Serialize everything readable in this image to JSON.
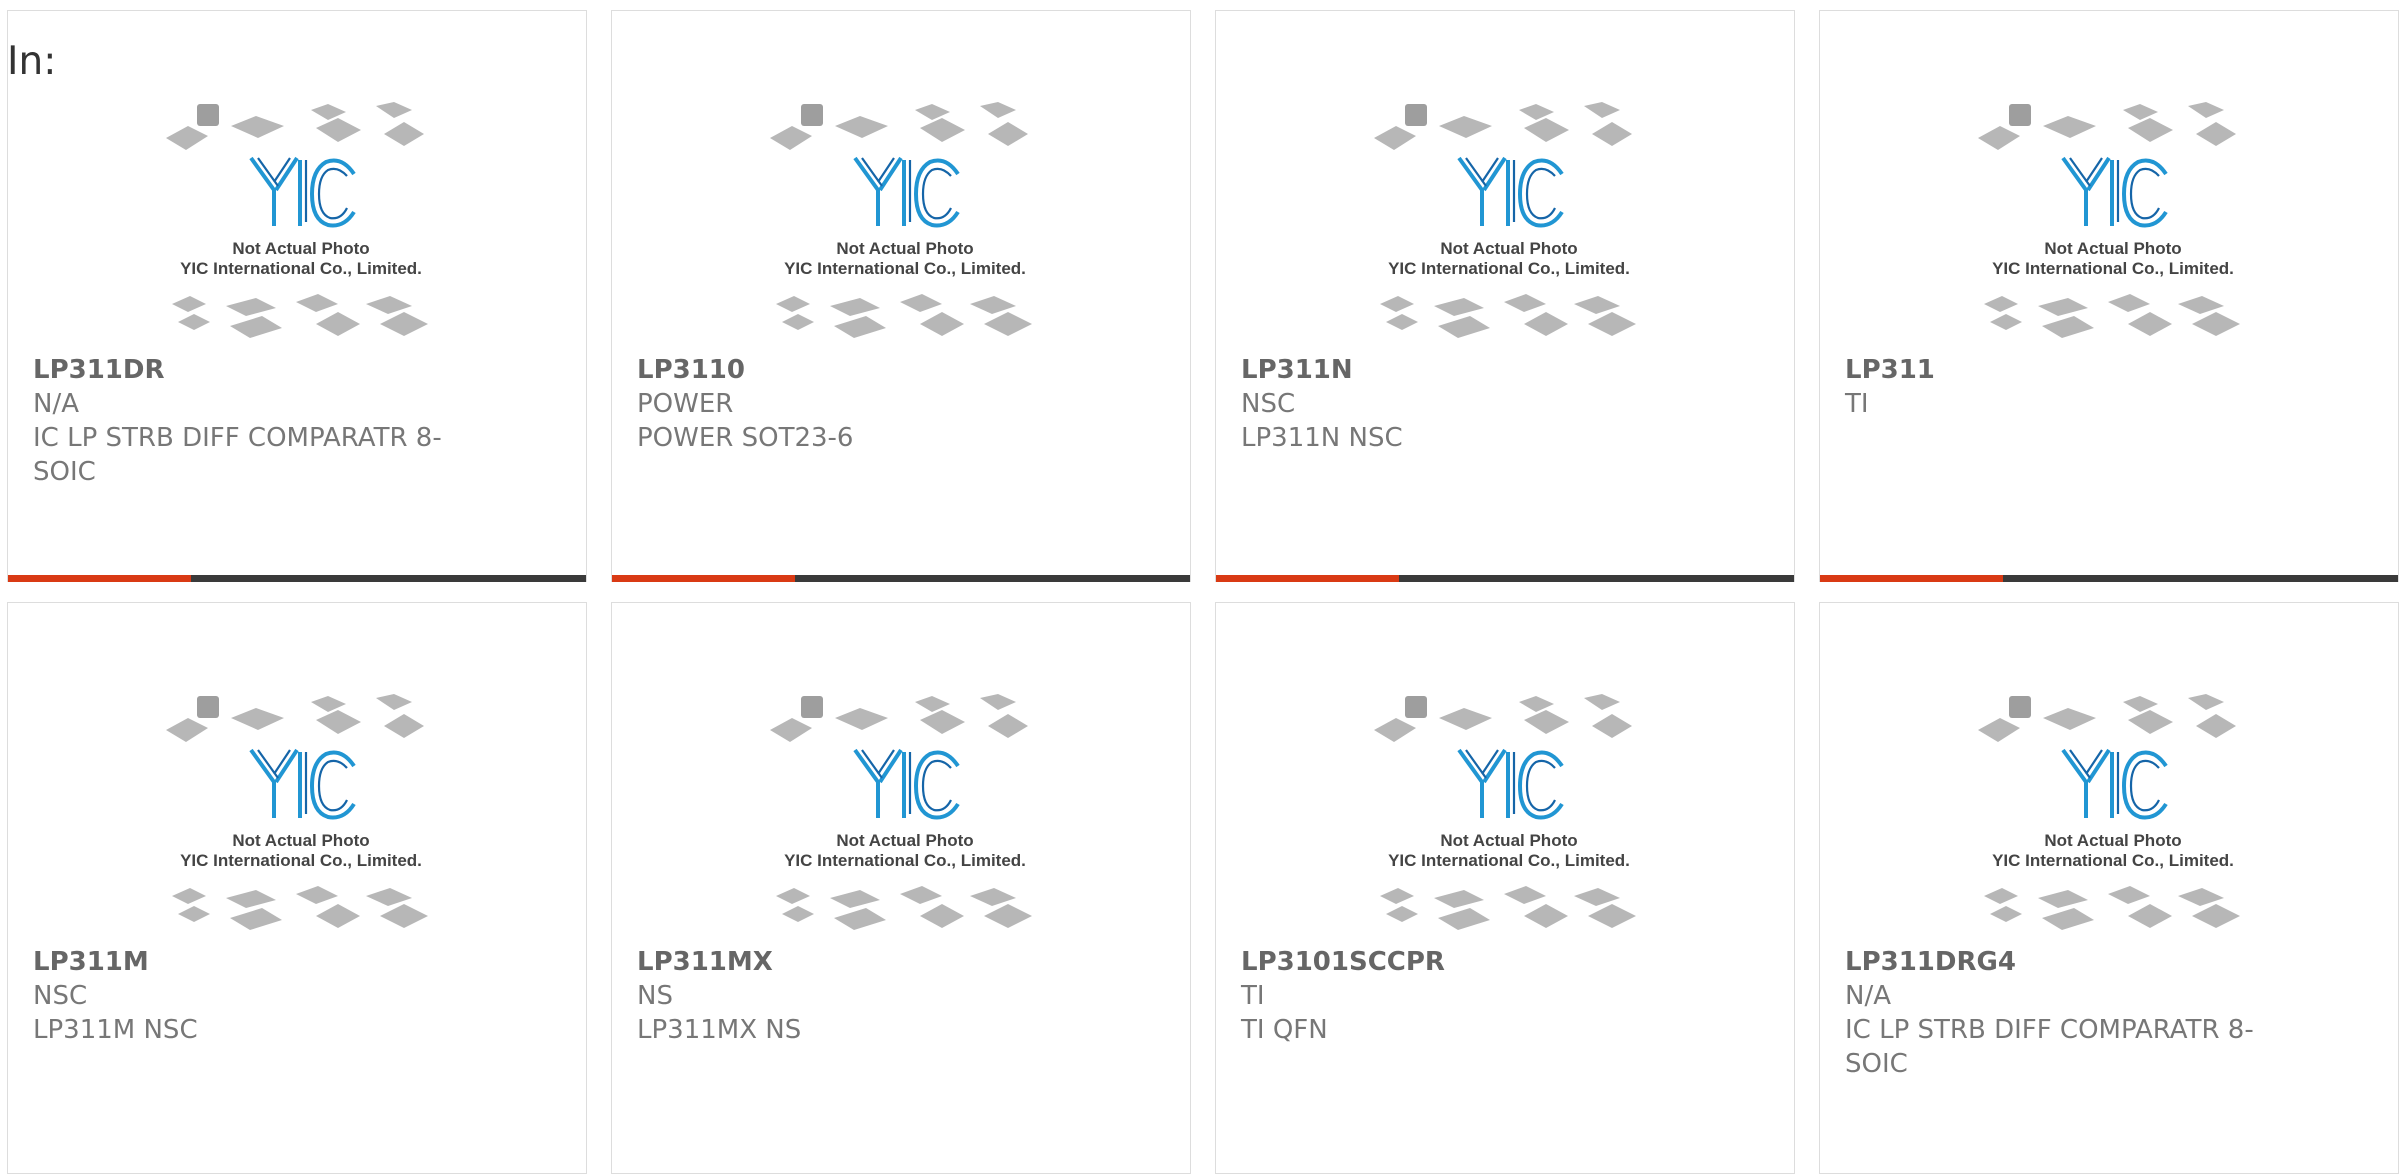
{
  "header": {
    "label": "In:"
  },
  "photo": {
    "logo": "YIC",
    "caption_line1": "Not Actual Photo",
    "caption_line2": "YIC International Co., Limited."
  },
  "products": [
    {
      "part": "LP311DR",
      "maker": "N/A",
      "desc": "IC LP STRB DIFF COMPARATR 8-SOIC",
      "has_bar": true
    },
    {
      "part": "LP3110",
      "maker": "POWER",
      "desc": "POWER SOT23-6",
      "has_bar": true
    },
    {
      "part": "LP311N",
      "maker": "NSC",
      "desc": "LP311N NSC",
      "has_bar": true
    },
    {
      "part": "LP311",
      "maker": "TI",
      "desc": "",
      "has_bar": true
    },
    {
      "part": "LP311M",
      "maker": "NSC",
      "desc": "LP311M NSC",
      "has_bar": false
    },
    {
      "part": "LP311MX",
      "maker": "NS",
      "desc": "LP311MX NS",
      "has_bar": false
    },
    {
      "part": "LP3101SCCPR",
      "maker": "TI",
      "desc": "TI QFN",
      "has_bar": false
    },
    {
      "part": "LP311DRG4",
      "maker": "N/A",
      "desc": "IC LP STRB DIFF COMPARATR 8-SOIC",
      "has_bar": false
    }
  ],
  "colors": {
    "accent": "#d93a14",
    "bar": "#3a3a3a",
    "logo": "#2196d3"
  }
}
